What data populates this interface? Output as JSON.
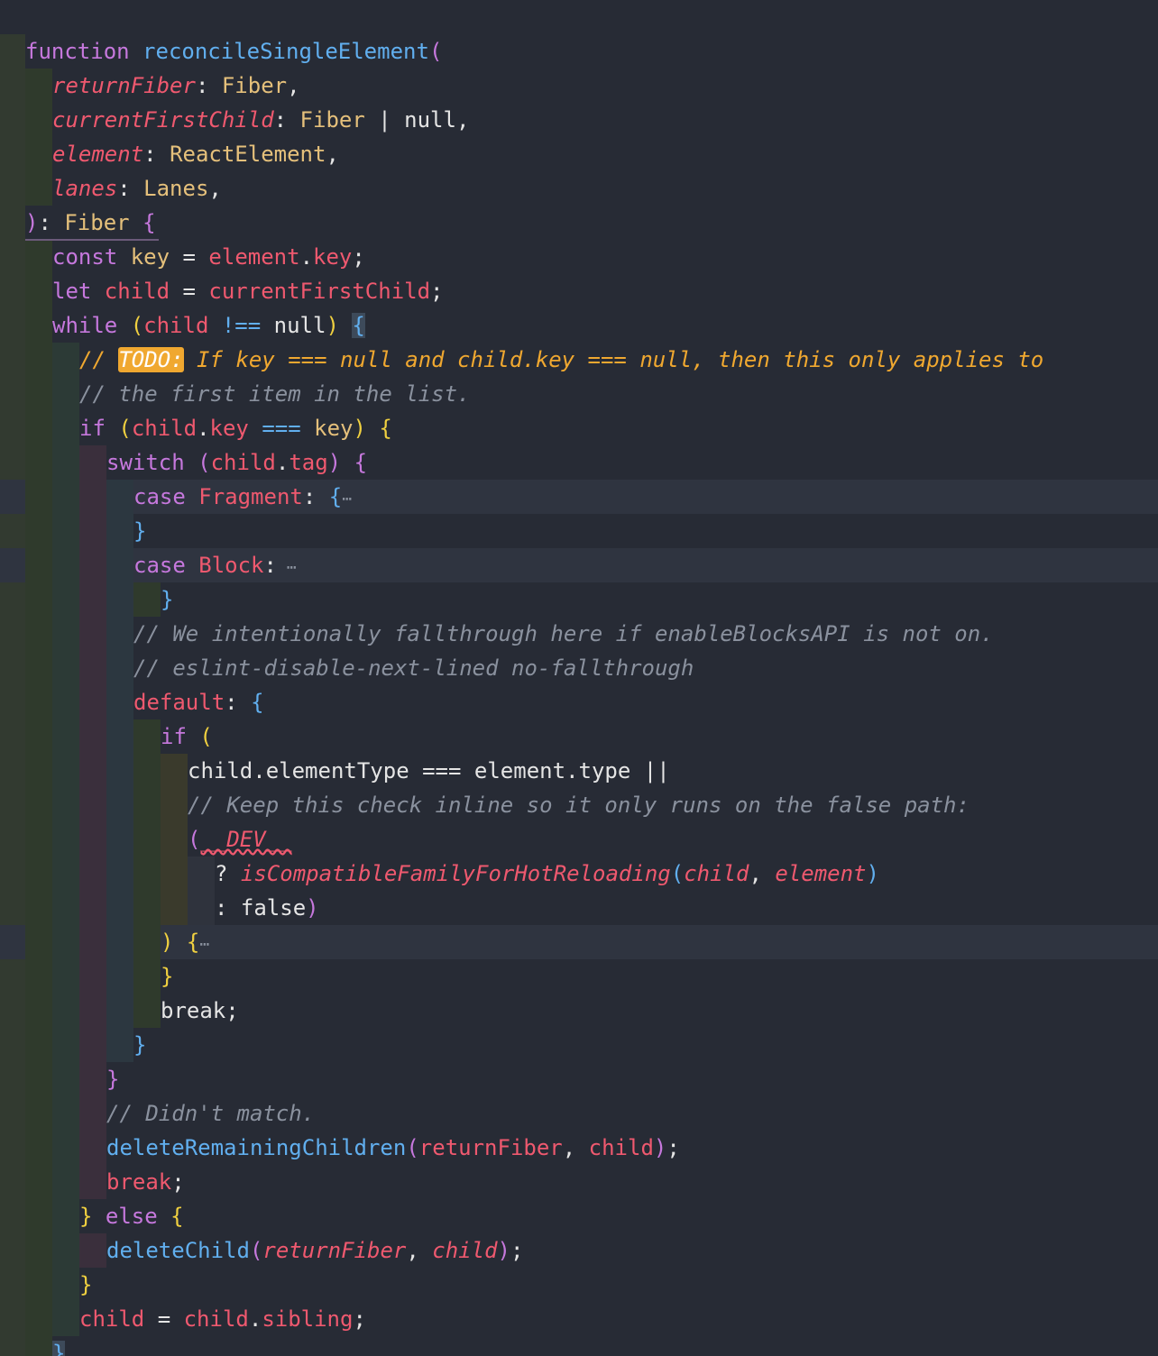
{
  "editor": {
    "language": "javascript",
    "lines": [
      {
        "indent": 0,
        "tokens": [
          {
            "t": "function ",
            "c": "kw"
          },
          {
            "t": "reconcileSingleElement",
            "c": "fn"
          },
          {
            "t": "(",
            "c": "bp"
          }
        ]
      },
      {
        "indent": 1,
        "tokens": [
          {
            "t": "returnFiber",
            "c": "par"
          },
          {
            "t": ": ",
            "c": "pl"
          },
          {
            "t": "Fiber",
            "c": "typ"
          },
          {
            "t": ",",
            "c": "pl"
          }
        ]
      },
      {
        "indent": 1,
        "tokens": [
          {
            "t": "currentFirstChild",
            "c": "par"
          },
          {
            "t": ": ",
            "c": "pl"
          },
          {
            "t": "Fiber",
            "c": "typ"
          },
          {
            "t": " | ",
            "c": "pl"
          },
          {
            "t": "null",
            "c": "pl"
          },
          {
            "t": ",",
            "c": "pl"
          }
        ]
      },
      {
        "indent": 1,
        "tokens": [
          {
            "t": "element",
            "c": "par"
          },
          {
            "t": ": ",
            "c": "pl"
          },
          {
            "t": "ReactElement",
            "c": "typ"
          },
          {
            "t": ",",
            "c": "pl"
          }
        ]
      },
      {
        "indent": 1,
        "tokens": [
          {
            "t": "lanes",
            "c": "par"
          },
          {
            "t": ": ",
            "c": "pl"
          },
          {
            "t": "Lanes",
            "c": "typ"
          },
          {
            "t": ",",
            "c": "pl"
          }
        ]
      },
      {
        "indent": 0,
        "tokens": [
          {
            "t": ")",
            "c": "bp"
          },
          {
            "t": ": ",
            "c": "pl"
          },
          {
            "t": "Fiber",
            "c": "typ"
          },
          {
            "t": " ",
            "c": "pl"
          },
          {
            "t": "{",
            "c": "bp"
          }
        ]
      },
      {
        "indent": 1,
        "tokens": [
          {
            "t": "const ",
            "c": "kw"
          },
          {
            "t": "key",
            "c": "typ"
          },
          {
            "t": " = ",
            "c": "pl"
          },
          {
            "t": "element",
            "c": "var"
          },
          {
            "t": ".",
            "c": "pl"
          },
          {
            "t": "key",
            "c": "var"
          },
          {
            "t": ";",
            "c": "pl"
          }
        ]
      },
      {
        "indent": 1,
        "tokens": [
          {
            "t": "let ",
            "c": "kw"
          },
          {
            "t": "child",
            "c": "var"
          },
          {
            "t": " = ",
            "c": "pl"
          },
          {
            "t": "currentFirstChild",
            "c": "var"
          },
          {
            "t": ";",
            "c": "pl"
          }
        ]
      },
      {
        "indent": 1,
        "tokens": [
          {
            "t": "while ",
            "c": "kw"
          },
          {
            "t": "(",
            "c": "by"
          },
          {
            "t": "child",
            "c": "var"
          },
          {
            "t": " !== ",
            "c": "op"
          },
          {
            "t": "null",
            "c": "pl"
          },
          {
            "t": ")",
            "c": "by"
          },
          {
            "t": " ",
            "c": "pl"
          },
          {
            "t": "{",
            "c": "bbsel"
          }
        ]
      },
      {
        "indent": 2,
        "tokens": [
          {
            "t": "// ",
            "c": "tagc"
          },
          {
            "t": "TODO:",
            "c": "todo"
          },
          {
            "t": " If key === null and child.key === null, then this only applies to",
            "c": "tagc"
          }
        ]
      },
      {
        "indent": 2,
        "tokens": [
          {
            "t": "// the first item in the list.",
            "c": "cmt"
          }
        ]
      },
      {
        "indent": 2,
        "tokens": [
          {
            "t": "if ",
            "c": "kw"
          },
          {
            "t": "(",
            "c": "by"
          },
          {
            "t": "child",
            "c": "var"
          },
          {
            "t": ".",
            "c": "pl"
          },
          {
            "t": "key",
            "c": "var"
          },
          {
            "t": " === ",
            "c": "op"
          },
          {
            "t": "key",
            "c": "typ"
          },
          {
            "t": ")",
            "c": "by"
          },
          {
            "t": " ",
            "c": "pl"
          },
          {
            "t": "{",
            "c": "by"
          }
        ]
      },
      {
        "indent": 3,
        "tokens": [
          {
            "t": "switch ",
            "c": "kw"
          },
          {
            "t": "(",
            "c": "bp"
          },
          {
            "t": "child",
            "c": "var"
          },
          {
            "t": ".",
            "c": "pl"
          },
          {
            "t": "tag",
            "c": "var"
          },
          {
            "t": ")",
            "c": "bp"
          },
          {
            "t": " ",
            "c": "pl"
          },
          {
            "t": "{",
            "c": "bp"
          }
        ]
      },
      {
        "indent": 4,
        "hl": true,
        "tokens": [
          {
            "t": "case ",
            "c": "kw"
          },
          {
            "t": "Fragment",
            "c": "var"
          },
          {
            "t": ": ",
            "c": "pl"
          },
          {
            "t": "{",
            "c": "bb"
          },
          {
            "t": "⋯",
            "c": "fold"
          }
        ]
      },
      {
        "indent": 4,
        "tokens": [
          {
            "t": "}",
            "c": "bb"
          }
        ]
      },
      {
        "indent": 4,
        "hl": true,
        "tokens": [
          {
            "t": "case ",
            "c": "kw"
          },
          {
            "t": "Block",
            "c": "var"
          },
          {
            "t": ":",
            "c": "pl"
          },
          {
            "t": " ⋯",
            "c": "fold"
          }
        ]
      },
      {
        "indent": 5,
        "tokens": [
          {
            "t": "}",
            "c": "bb"
          }
        ]
      },
      {
        "indent": 4,
        "tokens": [
          {
            "t": "// We intentionally fallthrough here if enableBlocksAPI is not on.",
            "c": "cmt"
          }
        ]
      },
      {
        "indent": 4,
        "tokens": [
          {
            "t": "// eslint-disable-next-lined no-fallthrough",
            "c": "cmt"
          }
        ]
      },
      {
        "indent": 4,
        "tokens": [
          {
            "t": "default",
            "c": "var"
          },
          {
            "t": ": ",
            "c": "pl"
          },
          {
            "t": "{",
            "c": "bb"
          }
        ]
      },
      {
        "indent": 5,
        "tokens": [
          {
            "t": "if ",
            "c": "kw"
          },
          {
            "t": "(",
            "c": "by"
          }
        ]
      },
      {
        "indent": 6,
        "tokens": [
          {
            "t": "child",
            "c": "pl"
          },
          {
            "t": ".",
            "c": "pl"
          },
          {
            "t": "elementType",
            "c": "pl"
          },
          {
            "t": " === ",
            "c": "pl"
          },
          {
            "t": "element",
            "c": "pl"
          },
          {
            "t": ".",
            "c": "pl"
          },
          {
            "t": "type",
            "c": "pl"
          },
          {
            "t": " ||",
            "c": "pl"
          }
        ]
      },
      {
        "indent": 6,
        "tokens": [
          {
            "t": "// Keep this check inline so it only runs on the false path:",
            "c": "cmt"
          }
        ]
      },
      {
        "indent": 6,
        "tokens": [
          {
            "t": "(",
            "c": "bp"
          },
          {
            "t": "__DEV__",
            "c": "dev"
          }
        ]
      },
      {
        "indent": 7,
        "tokens": [
          {
            "t": "? ",
            "c": "pl"
          },
          {
            "t": "isCompatibleFamilyForHotReloading",
            "c": "par"
          },
          {
            "t": "(",
            "c": "bb"
          },
          {
            "t": "child",
            "c": "par"
          },
          {
            "t": ", ",
            "c": "pl"
          },
          {
            "t": "element",
            "c": "par"
          },
          {
            "t": ")",
            "c": "bb"
          }
        ]
      },
      {
        "indent": 7,
        "tokens": [
          {
            "t": ": ",
            "c": "pl"
          },
          {
            "t": "false",
            "c": "pl"
          },
          {
            "t": ")",
            "c": "bp"
          }
        ]
      },
      {
        "indent": 5,
        "hl": true,
        "tokens": [
          {
            "t": ")",
            "c": "by"
          },
          {
            "t": " ",
            "c": "pl"
          },
          {
            "t": "{",
            "c": "by"
          },
          {
            "t": "⋯",
            "c": "fold"
          }
        ]
      },
      {
        "indent": 5,
        "tokens": [
          {
            "t": "}",
            "c": "by"
          }
        ]
      },
      {
        "indent": 5,
        "tokens": [
          {
            "t": "break",
            "c": "pl"
          },
          {
            "t": ";",
            "c": "pl"
          }
        ]
      },
      {
        "indent": 4,
        "tokens": [
          {
            "t": "}",
            "c": "bb"
          }
        ]
      },
      {
        "indent": 3,
        "tokens": [
          {
            "t": "}",
            "c": "bp"
          }
        ]
      },
      {
        "indent": 3,
        "tokens": [
          {
            "t": "// Didn't match.",
            "c": "cmt"
          }
        ]
      },
      {
        "indent": 3,
        "tokens": [
          {
            "t": "deleteRemainingChildren",
            "c": "fn"
          },
          {
            "t": "(",
            "c": "bp"
          },
          {
            "t": "returnFiber",
            "c": "var"
          },
          {
            "t": ", ",
            "c": "pl"
          },
          {
            "t": "child",
            "c": "var"
          },
          {
            "t": ")",
            "c": "bp"
          },
          {
            "t": ";",
            "c": "pl"
          }
        ]
      },
      {
        "indent": 3,
        "tokens": [
          {
            "t": "break",
            "c": "var"
          },
          {
            "t": ";",
            "c": "pl"
          }
        ]
      },
      {
        "indent": 2,
        "tokens": [
          {
            "t": "}",
            "c": "by"
          },
          {
            "t": " else ",
            "c": "kw"
          },
          {
            "t": "{",
            "c": "by"
          }
        ]
      },
      {
        "indent": 3,
        "tokens": [
          {
            "t": "deleteChild",
            "c": "fn"
          },
          {
            "t": "(",
            "c": "bp"
          },
          {
            "t": "returnFiber",
            "c": "par"
          },
          {
            "t": ", ",
            "c": "pl"
          },
          {
            "t": "child",
            "c": "par"
          },
          {
            "t": ")",
            "c": "bp"
          },
          {
            "t": ";",
            "c": "pl"
          }
        ]
      },
      {
        "indent": 2,
        "tokens": [
          {
            "t": "}",
            "c": "by"
          }
        ]
      },
      {
        "indent": 2,
        "tokens": [
          {
            "t": "child",
            "c": "var"
          },
          {
            "t": " = ",
            "c": "pl"
          },
          {
            "t": "child",
            "c": "var"
          },
          {
            "t": ".",
            "c": "pl"
          },
          {
            "t": "sibling",
            "c": "var"
          },
          {
            "t": ";",
            "c": "pl"
          }
        ]
      },
      {
        "indent": 1,
        "tokens": [
          {
            "t": "}",
            "c": "bbsel"
          }
        ]
      }
    ],
    "colors": {
      "background": "#272b35",
      "keyword": "#c678dd",
      "function": "#61afef",
      "parameter": "#ef596f",
      "type": "#e5c07b",
      "comment": "#8a919e",
      "todo_highlight": "#f0a830"
    }
  }
}
